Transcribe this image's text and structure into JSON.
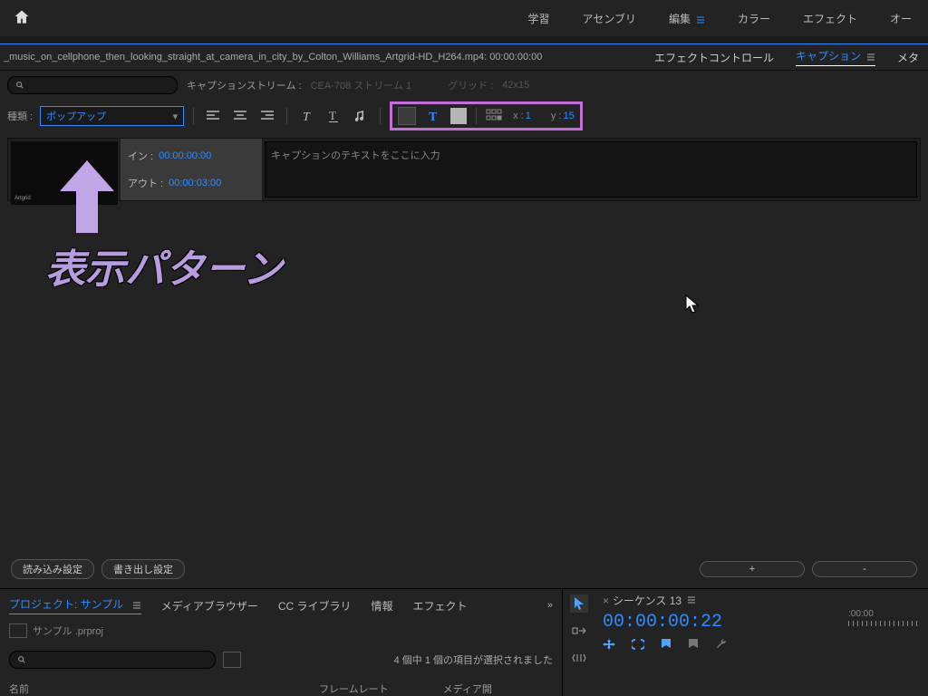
{
  "topnav": {
    "items": [
      "学習",
      "アセンブリ",
      "編集",
      "カラー",
      "エフェクト",
      "オー"
    ],
    "active": 2
  },
  "file": {
    "name": "_music_on_cellphone_then_looking_straight_at_camera_in_city_by_Colton_Williams_Artgrid-HD_H264.mp4: 00:00:00:00"
  },
  "right_tabs": {
    "effect": "エフェクトコントロール",
    "caption": "キャプション",
    "meta": "メタ"
  },
  "row2": {
    "stream_label": "キャプションストリーム :",
    "stream_value": "CEA-708 ストリーム 1",
    "grid_label": "グリッド :",
    "grid_value": "42x15"
  },
  "row3": {
    "type_label": "種類 :",
    "type_value": "ポップアップ",
    "x_label": "x :",
    "x_value": "1",
    "y_label": "y :",
    "y_value": "15"
  },
  "entry": {
    "in_label": "イン :",
    "in_value": "00:00:00:00",
    "out_label": "アウト :",
    "out_value": "00:00:03:00",
    "placeholder": "キャプションのテキストをここに入力"
  },
  "annotation": "表示パターン",
  "bottom": {
    "import": "読み込み設定",
    "export": "書き出し設定",
    "plus": "+",
    "minus": "-"
  },
  "project": {
    "tabs": [
      "プロジェクト: サンプル",
      "メディアブラウザー",
      "CC ライブラリ",
      "情報",
      "エフェクト"
    ],
    "name": "サンプル .prproj",
    "selection": "4 個中 1 個の項目が選択されました",
    "cols": [
      "名前",
      "フレームレート",
      "メディア開"
    ]
  },
  "sequence": {
    "tab": "シーケンス 13",
    "timecode": "00:00:00:22",
    "ruler": ":00:00"
  }
}
